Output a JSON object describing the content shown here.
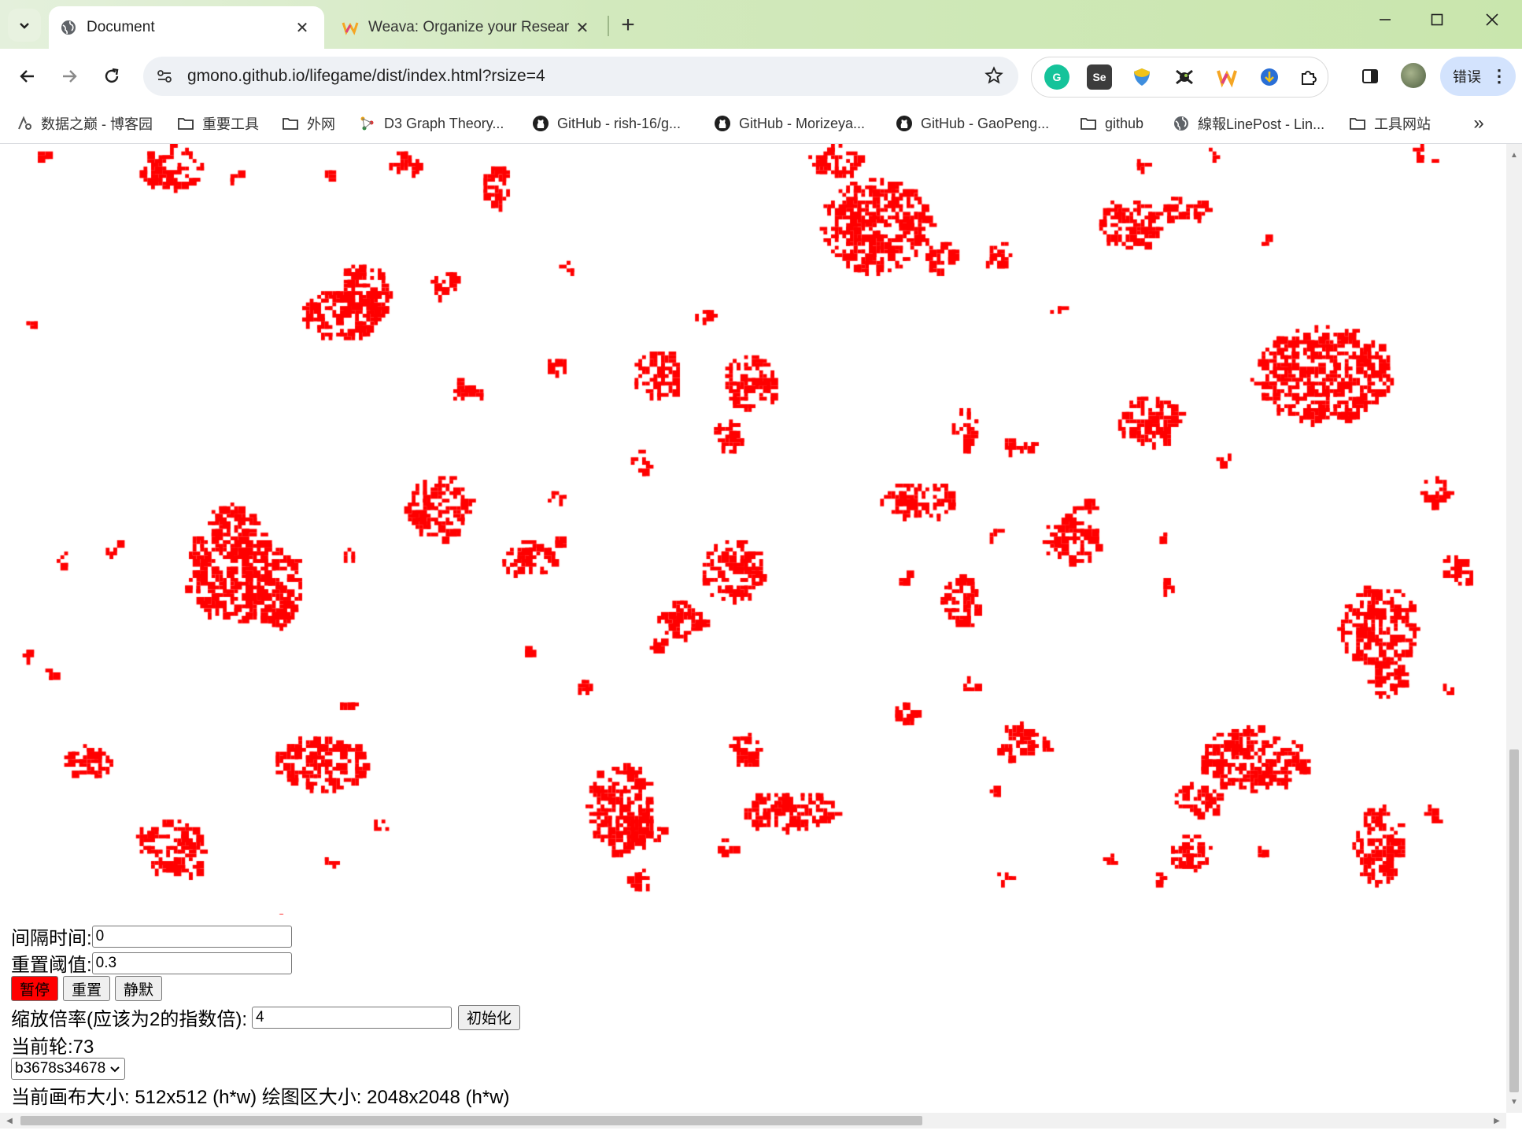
{
  "browser": {
    "tabs": [
      {
        "title": "Document",
        "active": true
      },
      {
        "title": "Weava: Organize your Resear",
        "active": false
      }
    ],
    "url": "gmono.github.io/lifegame/dist/index.html?rsize=4",
    "error_button_label": "错误",
    "bookmarks": [
      "数据之巅 - 博客园",
      "重要工具",
      "外网",
      "D3 Graph Theory...",
      "GitHub - rish-16/g...",
      "GitHub - Morizeya...",
      "GitHub - GaoPeng...",
      "github",
      "線報LinePost - Lin...",
      "工具网站"
    ],
    "extensions": [
      "grammarly-icon",
      "selenium-icon",
      "shield-icon",
      "puzzle-spider-icon",
      "weava-icon",
      "download-icon",
      "extensions-icon"
    ]
  },
  "life": {
    "cell_color": "#ff0000",
    "background_color": "#ffffff"
  },
  "controls": {
    "interval_label": "间隔时间:",
    "interval_value": "0",
    "reset_threshold_label": "重置阈值:",
    "reset_threshold_value": "0.3",
    "pause_label": "暂停",
    "reset_label": "重置",
    "mute_label": "静默",
    "scale_label": "缩放倍率(应该为2的指数倍):",
    "scale_value": "4",
    "init_label": "初始化",
    "round_text": "当前轮:73",
    "rule_selected": "b3678s34678",
    "size_text": "当前画布大小: 512x512 (h*w) 绘图区大小: 2048x2048 (h*w)"
  }
}
